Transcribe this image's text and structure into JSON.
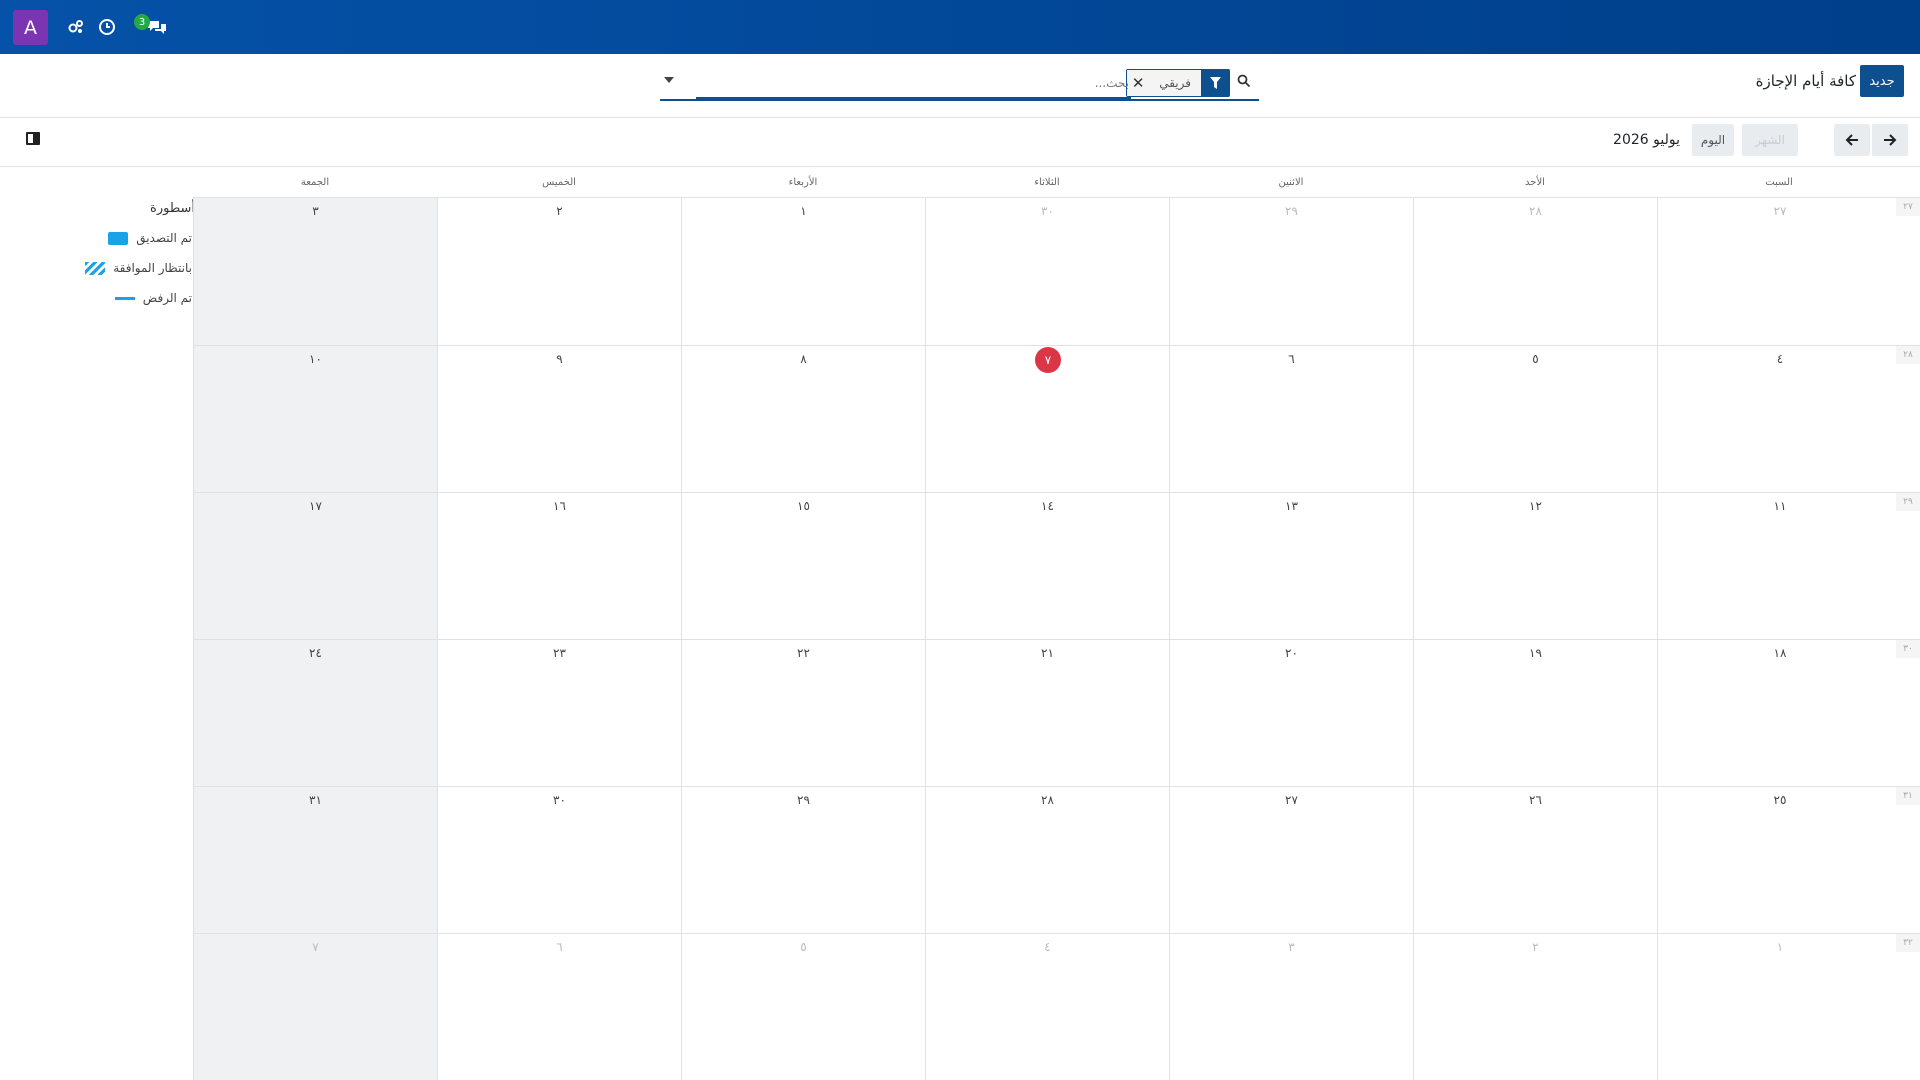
{
  "navbar": {
    "user_initial": "A",
    "chat_badge": "3",
    "icons": [
      "activity-icon",
      "clock-icon",
      "chat-icon"
    ]
  },
  "control_panel": {
    "new_button": "جديد",
    "breadcrumb": "كافة أيام الإجازة",
    "search": {
      "facet_value": "فريقي",
      "placeholder": "بحث..."
    }
  },
  "toolbar": {
    "period_label": "يوليو 2026",
    "today_button": "اليوم",
    "scale_button": "الشهر"
  },
  "legend": {
    "title": "أسطورة",
    "items": [
      {
        "label": "تم التصديق",
        "style": "solid",
        "color": "#19a3e6"
      },
      {
        "label": "بانتظار الموافقة",
        "style": "hatched",
        "color": "#19a3e6"
      },
      {
        "label": "تم الرفض",
        "style": "line",
        "color": "#19a3e6"
      }
    ]
  },
  "calendar": {
    "weekdays": [
      "السبت",
      "الأحد",
      "الاثنين",
      "الثلاثاء",
      "الأربعاء",
      "الخميس",
      "الجمعة"
    ],
    "week_numbers": [
      "٢٧",
      "٢٨",
      "٢٩",
      "٣٠",
      "٣١",
      "٣٢"
    ],
    "weeks": [
      [
        {
          "d": "٢٧",
          "muted": true
        },
        {
          "d": "٢٨",
          "muted": true
        },
        {
          "d": "٢٩",
          "muted": true
        },
        {
          "d": "٣٠",
          "muted": true
        },
        {
          "d": "١"
        },
        {
          "d": "٢"
        },
        {
          "d": "٣"
        }
      ],
      [
        {
          "d": "٤"
        },
        {
          "d": "٥"
        },
        {
          "d": "٦"
        },
        {
          "d": "٧",
          "today": true
        },
        {
          "d": "٨"
        },
        {
          "d": "٩"
        },
        {
          "d": "١٠"
        }
      ],
      [
        {
          "d": "١١"
        },
        {
          "d": "١٢"
        },
        {
          "d": "١٣"
        },
        {
          "d": "١٤"
        },
        {
          "d": "١٥"
        },
        {
          "d": "١٦"
        },
        {
          "d": "١٧"
        }
      ],
      [
        {
          "d": "١٨"
        },
        {
          "d": "١٩"
        },
        {
          "d": "٢٠"
        },
        {
          "d": "٢١"
        },
        {
          "d": "٢٢"
        },
        {
          "d": "٢٣"
        },
        {
          "d": "٢٤"
        }
      ],
      [
        {
          "d": "٢٥"
        },
        {
          "d": "٢٦"
        },
        {
          "d": "٢٧"
        },
        {
          "d": "٢٨"
        },
        {
          "d": "٢٩"
        },
        {
          "d": "٣٠"
        },
        {
          "d": "٣١"
        }
      ],
      [
        {
          "d": "١",
          "muted": true
        },
        {
          "d": "٢",
          "muted": true
        },
        {
          "d": "٣",
          "muted": true
        },
        {
          "d": "٤",
          "muted": true
        },
        {
          "d": "٥",
          "muted": true
        },
        {
          "d": "٦",
          "muted": true
        },
        {
          "d": "٧",
          "muted": true
        }
      ]
    ],
    "today_color": "#dc3545"
  }
}
